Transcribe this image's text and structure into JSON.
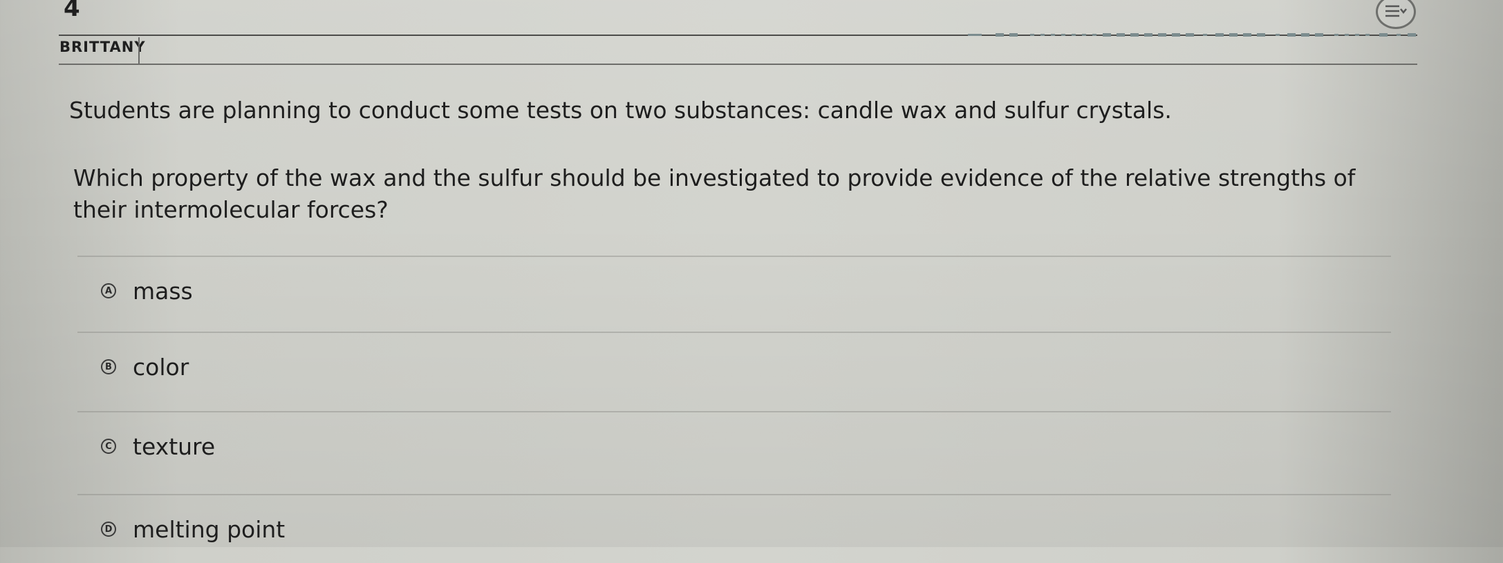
{
  "header": {
    "question_number": "4",
    "student_name": "BRITTANY",
    "menu_icon": "list-menu-icon"
  },
  "question": {
    "intro": "Students are planning to conduct some tests on two substances: candle wax and sulfur crystals.",
    "prompt": "Which property of the wax and the sulfur should be investigated to provide evidence of the relative strengths of their intermolecular forces?"
  },
  "choices": [
    {
      "letter": "A",
      "text": "mass"
    },
    {
      "letter": "B",
      "text": "color"
    },
    {
      "letter": "C",
      "text": "texture"
    },
    {
      "letter": "D",
      "text": "melting point"
    }
  ]
}
